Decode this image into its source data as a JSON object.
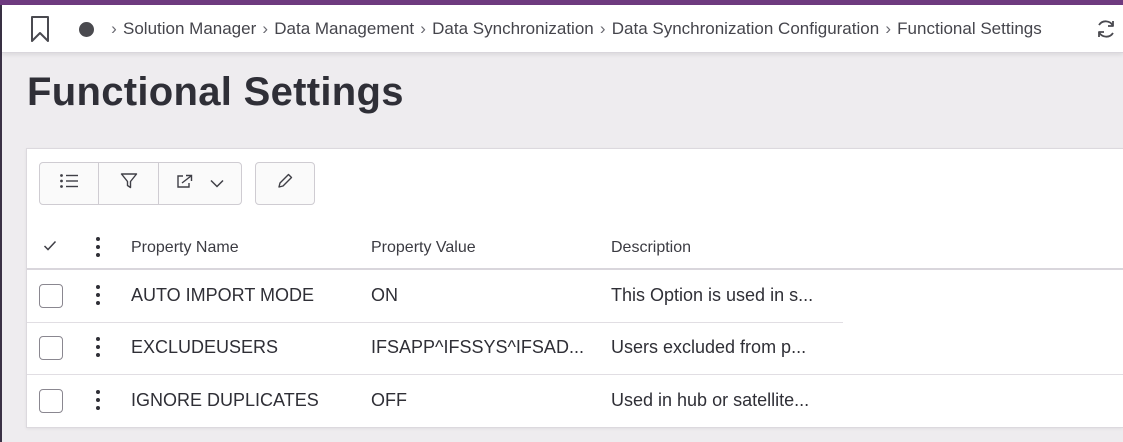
{
  "breadcrumb": {
    "items": [
      "Solution Manager",
      "Data Management",
      "Data Synchronization",
      "Data Synchronization Configuration",
      "Functional Settings"
    ]
  },
  "page": {
    "title": "Functional Settings"
  },
  "table": {
    "columns": [
      "Property Name",
      "Property Value",
      "Description"
    ],
    "rows": [
      {
        "property_name": "AUTO IMPORT MODE",
        "property_value": "ON",
        "description": "This Option is used in s..."
      },
      {
        "property_name": "EXCLUDEUSERS",
        "property_value": "IFSAPP^IFSSYS^IFSAD...",
        "description": "Users excluded from p..."
      },
      {
        "property_name": "IGNORE DUPLICATES",
        "property_value": "OFF",
        "description": "Used in hub or satellite..."
      }
    ]
  },
  "toolbar": {
    "icons": [
      "list-settings-icon",
      "filter-icon",
      "export-icon",
      "chevron-down-icon",
      "edit-pencil-icon"
    ]
  },
  "colors": {
    "accent": "#6e3a7f",
    "background": "#eeecef",
    "panel": "#ffffff"
  }
}
